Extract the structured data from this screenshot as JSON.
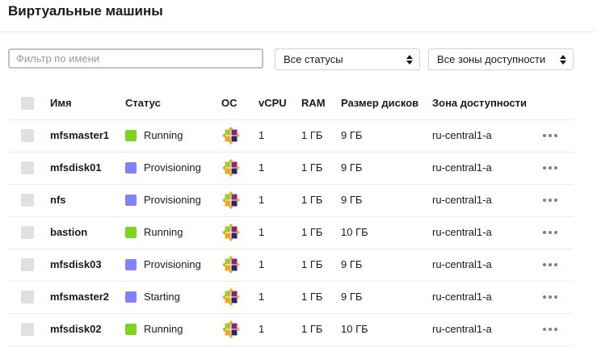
{
  "page": {
    "title": "Виртуальные машины"
  },
  "filters": {
    "name_placeholder": "Фильтр по имени",
    "status_value": "Все статусы",
    "zone_value": "Все зоны доступности"
  },
  "table": {
    "headers": [
      "Имя",
      "Статус",
      "ОС",
      "vCPU",
      "RAM",
      "Размер дисков",
      "Зона доступности"
    ],
    "rows": [
      {
        "name": "mfsmaster1",
        "status": "Running",
        "status_color": "#7ed321",
        "os_icon": "centos-icon",
        "vcpu": "1",
        "ram": "1 ГБ",
        "disk": "9 ГБ",
        "zone": "ru-central1-a"
      },
      {
        "name": "mfsdisk01",
        "status": "Provisioning",
        "status_color": "#8083ff",
        "os_icon": "centos-icon",
        "vcpu": "1",
        "ram": "1 ГБ",
        "disk": "9 ГБ",
        "zone": "ru-central1-a"
      },
      {
        "name": "nfs",
        "status": "Provisioning",
        "status_color": "#8083ff",
        "os_icon": "centos-icon",
        "vcpu": "1",
        "ram": "1 ГБ",
        "disk": "9 ГБ",
        "zone": "ru-central1-a"
      },
      {
        "name": "bastion",
        "status": "Running",
        "status_color": "#7ed321",
        "os_icon": "centos-icon",
        "vcpu": "1",
        "ram": "1 ГБ",
        "disk": "10 ГБ",
        "zone": "ru-central1-a"
      },
      {
        "name": "mfsdisk03",
        "status": "Provisioning",
        "status_color": "#8083ff",
        "os_icon": "centos-icon",
        "vcpu": "1",
        "ram": "1 ГБ",
        "disk": "9 ГБ",
        "zone": "ru-central1-a"
      },
      {
        "name": "mfsmaster2",
        "status": "Starting",
        "status_color": "#8083ff",
        "os_icon": "centos-icon",
        "vcpu": "1",
        "ram": "1 ГБ",
        "disk": "9 ГБ",
        "zone": "ru-central1-a"
      },
      {
        "name": "mfsdisk02",
        "status": "Running",
        "status_color": "#7ed321",
        "os_icon": "centos-icon",
        "vcpu": "1",
        "ram": "1 ГБ",
        "disk": "10 ГБ",
        "zone": "ru-central1-a"
      }
    ]
  }
}
